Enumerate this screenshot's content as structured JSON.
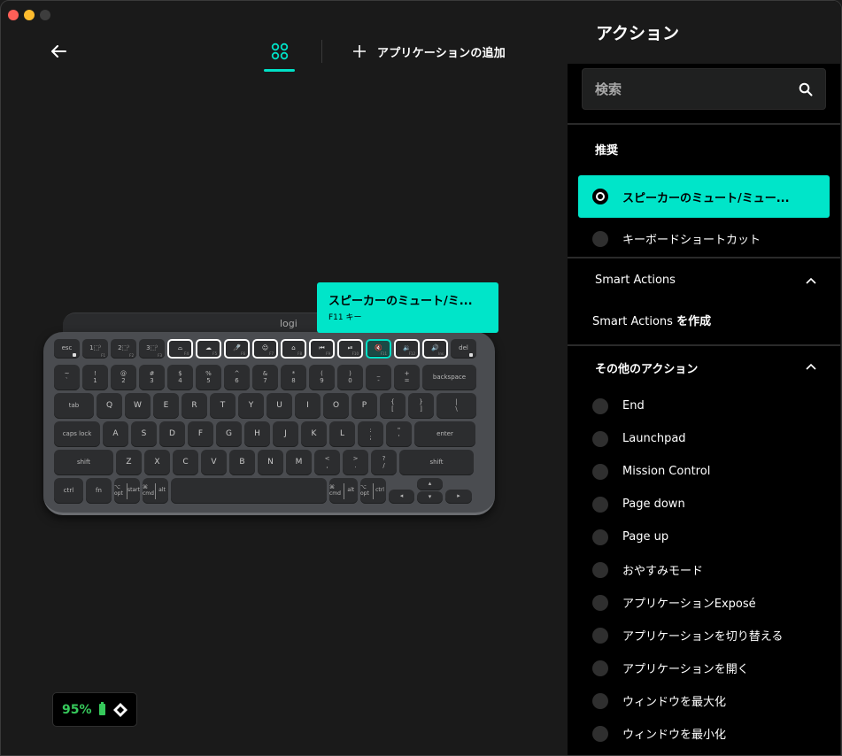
{
  "window": {
    "controls": [
      "close",
      "minimize",
      "zoom"
    ]
  },
  "header": {
    "back_icon": "arrow-left-icon",
    "apps_icon": "four-circles-icon",
    "add_app_label": "アプリケーションの追加",
    "add_icon": "plus-icon"
  },
  "keyboard": {
    "logo": "logi",
    "rows": [
      [
        {
          "top": "esc",
          "lock": true,
          "w": 29,
          "fn": true
        },
        {
          "top": "1⬚⁾",
          "sub": "F1",
          "w": 29,
          "fn": true
        },
        {
          "top": "2⬚⁾",
          "sub": "F2",
          "w": 29,
          "fn": true
        },
        {
          "top": "3⬚⁾",
          "sub": "F3",
          "w": 29,
          "fn": true
        },
        {
          "top": "⌓",
          "sub": "F4",
          "w": 29,
          "fn": true,
          "hl": true
        },
        {
          "top": "☁",
          "sub": "F5",
          "w": 29,
          "fn": true,
          "hl": true
        },
        {
          "top": "🎤̸",
          "sub": "F6",
          "w": 29,
          "fn": true,
          "hl": true
        },
        {
          "top": "☺",
          "sub": "F7",
          "w": 29,
          "fn": true,
          "hl": true
        },
        {
          "top": "⌂",
          "sub": "F8",
          "w": 29,
          "fn": true,
          "hl": true
        },
        {
          "top": "⏮",
          "sub": "F9",
          "w": 29,
          "fn": true,
          "hl": true
        },
        {
          "top": "⏯",
          "sub": "F10",
          "w": 29,
          "fn": true,
          "hl": true
        },
        {
          "top": "🔇",
          "sub": "F11",
          "w": 29,
          "fn": true,
          "active": true
        },
        {
          "top": "🔉",
          "sub": "F12",
          "w": 29,
          "fn": true,
          "hl": true
        },
        {
          "top": "🔊",
          "sub": "Ins",
          "w": 29,
          "fn": true,
          "hl": true
        },
        {
          "top": "del",
          "lock": true,
          "w": 29,
          "fn": true
        }
      ],
      [
        {
          "top": "~",
          "bot": "`",
          "w": 29
        },
        {
          "top": "!",
          "bot": "1",
          "w": 29
        },
        {
          "top": "@",
          "bot": "2",
          "w": 29
        },
        {
          "top": "#",
          "bot": "3",
          "w": 29
        },
        {
          "top": "$",
          "bot": "4",
          "w": 29
        },
        {
          "top": "%",
          "bot": "5",
          "w": 29
        },
        {
          "top": "^",
          "bot": "6",
          "w": 29
        },
        {
          "top": "&",
          "bot": "7",
          "w": 29
        },
        {
          "top": "*",
          "bot": "8",
          "w": 29
        },
        {
          "top": "(",
          "bot": "9",
          "w": 29
        },
        {
          "top": ")",
          "bot": "0",
          "w": 29
        },
        {
          "top": "_",
          "bot": "-",
          "w": 29
        },
        {
          "top": "+",
          "bot": "=",
          "w": 29
        },
        {
          "top": "backspace",
          "w": 61
        }
      ],
      [
        {
          "top": "tab",
          "w": 45
        },
        {
          "big": "Q",
          "w": 29
        },
        {
          "big": "W",
          "w": 29
        },
        {
          "big": "E",
          "w": 29
        },
        {
          "big": "R",
          "w": 29
        },
        {
          "big": "T",
          "w": 29
        },
        {
          "big": "Y",
          "w": 29
        },
        {
          "big": "U",
          "w": 29
        },
        {
          "big": "I",
          "w": 29
        },
        {
          "big": "O",
          "w": 29
        },
        {
          "big": "P",
          "w": 29
        },
        {
          "top": "{",
          "bot": "[",
          "w": 29
        },
        {
          "top": "}",
          "bot": "]",
          "w": 29
        },
        {
          "top": "|",
          "bot": "\\",
          "w": 45
        }
      ],
      [
        {
          "top": "caps lock",
          "w": 52
        },
        {
          "big": "A",
          "w": 29
        },
        {
          "big": "S",
          "w": 29
        },
        {
          "big": "D",
          "w": 29
        },
        {
          "big": "F",
          "w": 29
        },
        {
          "big": "G",
          "w": 29
        },
        {
          "big": "H",
          "w": 29
        },
        {
          "big": "J",
          "w": 29
        },
        {
          "big": "K",
          "w": 29
        },
        {
          "big": "L",
          "w": 29
        },
        {
          "top": ":",
          "bot": ";",
          "w": 29
        },
        {
          "top": "\"",
          "bot": "'",
          "w": 29
        },
        {
          "top": "enter",
          "w": 69
        }
      ],
      [
        {
          "top": "shift",
          "w": 67
        },
        {
          "big": "Z",
          "w": 29
        },
        {
          "big": "X",
          "w": 29
        },
        {
          "big": "C",
          "w": 29
        },
        {
          "big": "V",
          "w": 29
        },
        {
          "big": "B",
          "w": 29
        },
        {
          "big": "N",
          "w": 29
        },
        {
          "big": "M",
          "w": 29
        },
        {
          "top": "<",
          "bot": ",",
          "w": 29
        },
        {
          "top": ">",
          "bot": ".",
          "w": 29
        },
        {
          "top": "?",
          "bot": "/",
          "w": 29
        },
        {
          "top": "shift",
          "w": 84
        }
      ],
      [
        {
          "top": "ctrl",
          "w": 33
        },
        {
          "top": "fn",
          "w": 29
        },
        {
          "split": [
            "⌥ opt",
            "start"
          ],
          "w": 29
        },
        {
          "split": [
            "⌘ cmd",
            "alt"
          ],
          "w": 29
        },
        {
          "space": true,
          "w": 176
        },
        {
          "split": [
            "⌘ cmd",
            "alt"
          ],
          "w": 32
        },
        {
          "split": [
            "⌥ opt",
            "ctrl"
          ],
          "w": 29
        },
        {
          "arrow": "◂",
          "w": 29
        },
        {
          "arrows_ud": [
            "▴",
            "▾"
          ],
          "w": 29
        },
        {
          "arrow": "▸",
          "w": 30
        }
      ]
    ]
  },
  "tooltip": {
    "title": "スピーカーのミュート/ミ...",
    "subtitle": "F11 キー"
  },
  "battery": {
    "percent": "95%",
    "level": 0.95,
    "status_color": "#36c95b",
    "connection_icon": "logi-bolt-icon"
  },
  "panel": {
    "title": "アクション",
    "search_placeholder": "検索",
    "recommended": {
      "title": "推奨",
      "items": [
        {
          "label": "スピーカーのミュート/ミュー...",
          "selected": true
        },
        {
          "label": "キーボードショートカット",
          "selected": false
        }
      ]
    },
    "smart_actions": {
      "title": "Smart Actions",
      "create_prefix": "Smart Actions ",
      "create_suffix": "を作成"
    },
    "other_actions": {
      "title": "その他のアクション",
      "items": [
        {
          "label": "End"
        },
        {
          "label": "Launchpad"
        },
        {
          "label": "Mission Control"
        },
        {
          "label": "Page down"
        },
        {
          "label": "Page up"
        },
        {
          "label": "おやすみモード"
        },
        {
          "label": "アプリケーションExposé"
        },
        {
          "label": "アプリケーションを切り替える"
        },
        {
          "label": "アプリケーションを開く"
        },
        {
          "label": "ウィンドウを最大化"
        },
        {
          "label": "ウィンドウを最小化"
        }
      ]
    }
  },
  "colors": {
    "accent": "#00e5c9",
    "background": "#1a1a1a",
    "panel_background": "#000000",
    "battery_green": "#36c95b"
  }
}
